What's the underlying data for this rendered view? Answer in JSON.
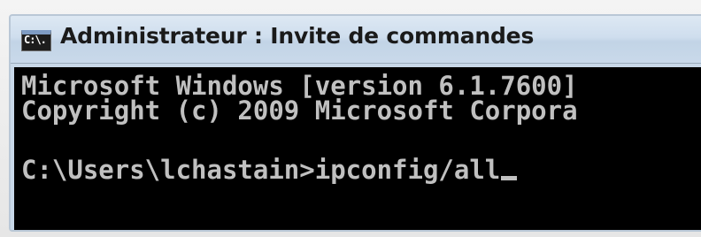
{
  "window": {
    "title": "Administrateur : Invite de commandes",
    "icon": "cmd-console-icon",
    "icon_text": "C:\\."
  },
  "console": {
    "lines": [
      "Microsoft Windows [version 6.1.7600]",
      "Copyright (c) 2009 Microsoft Corpora"
    ],
    "prompt": "C:\\Users\\lchastain>",
    "command": "ipconfig/all"
  },
  "colors": {
    "console_bg": "#000000",
    "console_text": "#c0c0c0",
    "titlebar": "#c9d9ea"
  }
}
